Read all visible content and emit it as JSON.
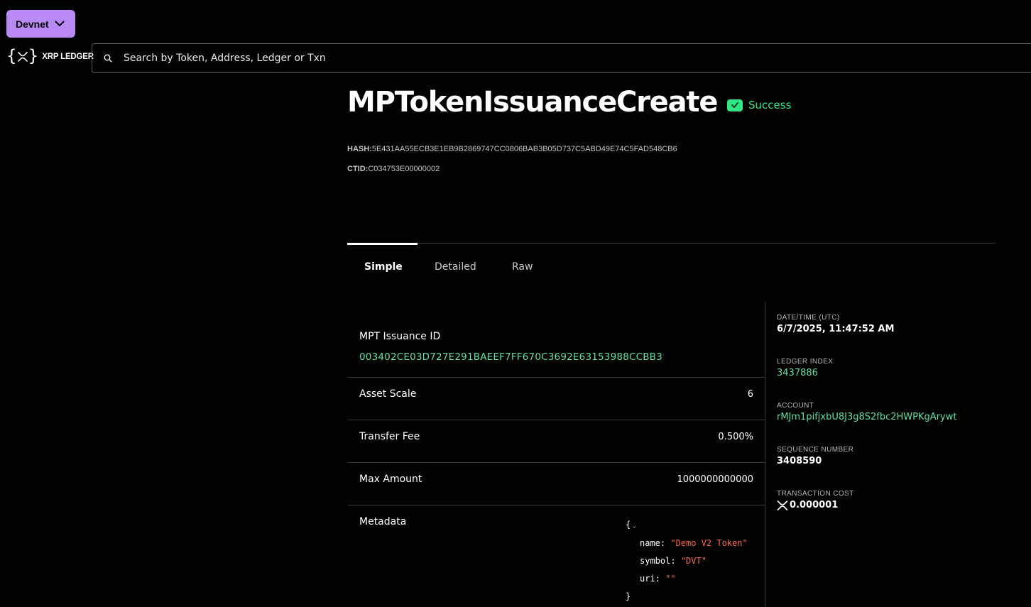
{
  "network": {
    "label": "Devnet"
  },
  "logo": {
    "text": "XRP LEDGER"
  },
  "search": {
    "placeholder": "Search by Token, Address, Ledger or Txn"
  },
  "transaction": {
    "type": "MPTokenIssuanceCreate",
    "status": "Success",
    "hash_label": "HASH:",
    "hash": "5E431AA55ECB3E1EB9B2869747CC0806BAB3B05D737C5ABD49E74C5FAD548CB6",
    "ctid_label": "CTID:",
    "ctid": "C034753E00000002"
  },
  "tabs": [
    {
      "label": "Simple",
      "active": true
    },
    {
      "label": "Detailed",
      "active": false
    },
    {
      "label": "Raw",
      "active": false
    }
  ],
  "simple": {
    "issuance_id_label": "MPT Issuance ID",
    "issuance_id": "003402CE03D727E291BAEEF7FF670C3692E63153988CCBB3",
    "asset_scale_label": "Asset Scale",
    "asset_scale": "6",
    "transfer_fee_label": "Transfer Fee",
    "transfer_fee": "0.500%",
    "max_amount_label": "Max Amount",
    "max_amount": "1000000000000",
    "metadata_label": "Metadata",
    "metadata": {
      "open": "{",
      "close": "}",
      "fields": [
        {
          "key": "name",
          "value": "\"Demo V2 Token\""
        },
        {
          "key": "symbol",
          "value": "\"DVT\""
        },
        {
          "key": "uri",
          "value": "\"\""
        }
      ]
    }
  },
  "details": {
    "datetime_label": "DATE/TIME (UTC)",
    "datetime": "6/7/2025, 11:47:52 AM",
    "ledger_index_label": "LEDGER INDEX",
    "ledger_index": "3437886",
    "account_label": "ACCOUNT",
    "account": "rMJm1pifjxbU8J3g8S2fbc2HWPKgArywt",
    "sequence_label": "SEQUENCE NUMBER",
    "sequence": "3408590",
    "cost_label": "TRANSACTION COST",
    "cost": "0.000001"
  },
  "colors": {
    "network_button": "#b98af5",
    "success": "#32e685",
    "link": "#5fe0a0",
    "json_string": "#ff6a4d"
  }
}
